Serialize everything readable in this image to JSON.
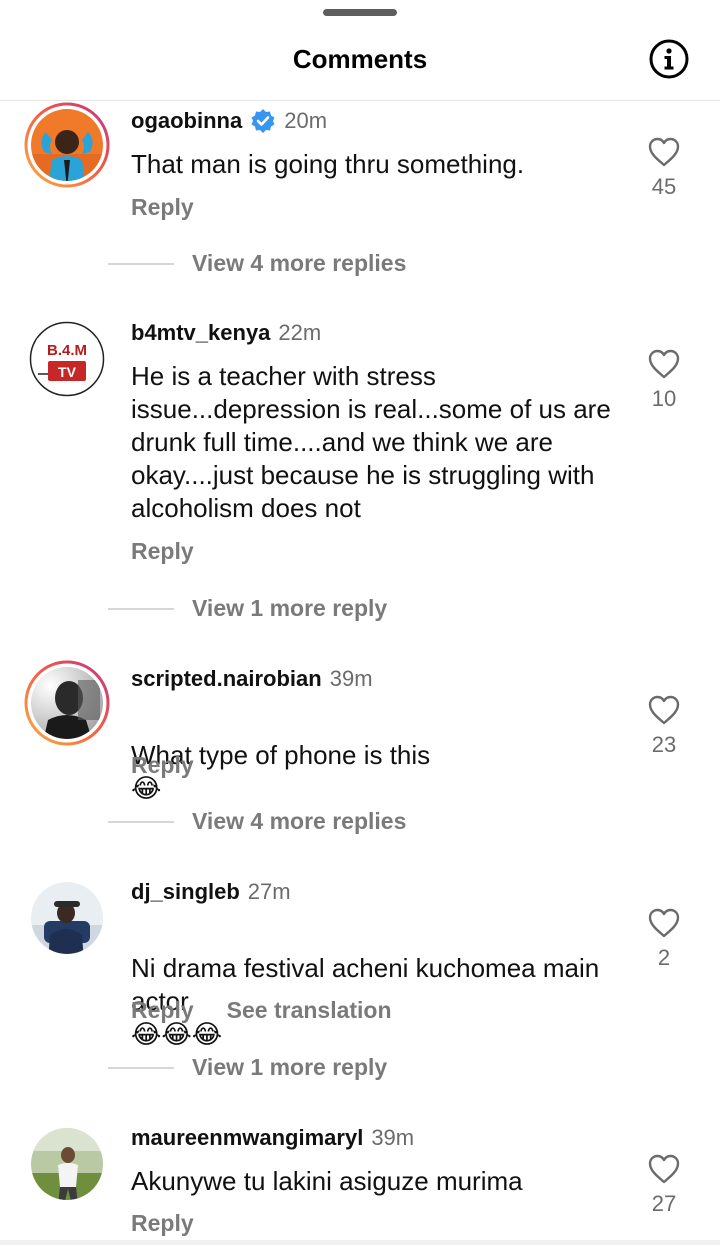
{
  "header": {
    "title": "Comments",
    "info_icon": "info-icon"
  },
  "comments": [
    {
      "username": "ogaobinna",
      "verified": true,
      "time": "20m",
      "text": "That man is going thru something.",
      "reply_label": "Reply",
      "likes": "45",
      "view_replies": "View 4 more replies",
      "avatar_ring": "story-gradient"
    },
    {
      "username": "b4mtv_kenya",
      "verified": false,
      "time": "22m",
      "text": "He is a teacher with stress issue...depression is real...some of us are drunk full time....and we think we are okay....just because he is struggling  with alcoholism  does not",
      "reply_label": "Reply",
      "likes": "10",
      "view_replies": "View 1 more reply",
      "avatar_label_top": "B.4.M",
      "avatar_label_bottom": "TV"
    },
    {
      "username": "scripted.nairobian",
      "verified": false,
      "time": "39m",
      "text": "What type of phone is this",
      "emoji": [
        "😂"
      ],
      "reply_label": "Reply",
      "likes": "23",
      "view_replies": "View 4 more replies",
      "avatar_ring": "story-gradient"
    },
    {
      "username": "dj_singleb",
      "verified": false,
      "time": "27m",
      "text": "Ni drama festival acheni kuchomea main actor",
      "emoji": [
        "😂",
        "😂",
        "😂"
      ],
      "reply_label": "Reply",
      "translate_label": "See translation",
      "likes": "2",
      "view_replies": "View 1 more reply"
    },
    {
      "username": "maureenmwangimaryl",
      "verified": false,
      "time": "39m",
      "text": "Akunywe tu lakini asiguze murima",
      "reply_label": "Reply",
      "likes": "27"
    }
  ],
  "colors": {
    "verified_blue": "#3797f0",
    "secondary_text": "#7a7a7a",
    "divider": "#e6e6e6",
    "ring_start": "#fcaf45",
    "ring_end": "#c13584"
  }
}
